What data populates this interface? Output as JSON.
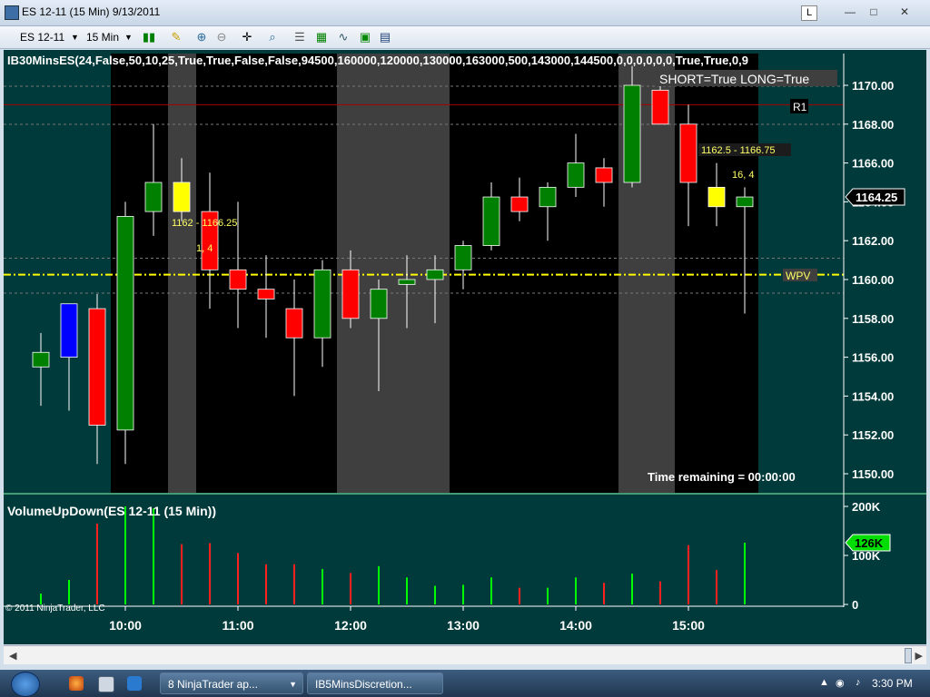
{
  "window": {
    "title": "ES 12-11 (15 Min)  9/13/2011",
    "l_label": "L",
    "min_btn": "—",
    "max_btn": "□",
    "close_btn": "✕"
  },
  "toolbar": {
    "instrument": "ES 12-11",
    "interval": "15 Min"
  },
  "indicator_label": "IB30MinsES(24,False,50,10,25,True,True,False,False,94500,160000,120000,130000,163000,500,143000,144500,0,0,0,0,0,0,True,True,0,9",
  "annotations": {
    "short_long": "SHORT=True LONG=True",
    "r1": "R1",
    "range1": "1162.5 - 1166.75",
    "range2": "1162 - 1166.25",
    "count1": "16, 4",
    "count2": "1, 4",
    "wpv": "WPV",
    "time_remaining": "Time remaining = 00:00:00",
    "last_price": "1164.25",
    "copyright": "© 2011 NinjaTrader, LLC"
  },
  "volume_panel": {
    "title": "VolumeUpDown(ES 12-11 (15 Min))",
    "last_volume": "126K"
  },
  "colors": {
    "bg": "#003a3a",
    "plot_black": "#000000",
    "session_gray": "#3f3f3f",
    "up": "#008000",
    "down": "#ff0000",
    "doji": "#ffff00",
    "blue": "#0000ff",
    "wpv": "#ffff00",
    "r1": "#aa0000"
  },
  "chart_data": {
    "type": "candlestick",
    "y_ticks": [
      "1170.00",
      "1168.00",
      "1166.00",
      "1164.00",
      "1162.00",
      "1160.00",
      "1158.00",
      "1156.00",
      "1154.00",
      "1152.00",
      "1150.00"
    ],
    "ylim": [
      1149,
      1171
    ],
    "x_ticks": [
      "10:00",
      "11:00",
      "12:00",
      "13:00",
      "14:00",
      "15:00"
    ],
    "r1_level": 1169,
    "wpv_level": 1160.25,
    "candles": [
      {
        "o": 1155.5,
        "h": 1157.25,
        "l": 1153.5,
        "c": 1156.25,
        "color": "up"
      },
      {
        "o": 1156,
        "h": 1158.75,
        "l": 1153.25,
        "c": 1158.75,
        "color": "blue"
      },
      {
        "o": 1158.5,
        "h": 1159.25,
        "l": 1150.5,
        "c": 1152.5,
        "color": "down"
      },
      {
        "o": 1152.25,
        "h": 1164,
        "l": 1150.5,
        "c": 1163.25,
        "color": "up"
      },
      {
        "o": 1163.5,
        "h": 1168,
        "l": 1162.25,
        "c": 1165,
        "color": "up"
      },
      {
        "o": 1165,
        "h": 1166.25,
        "l": 1163,
        "c": 1163.5,
        "color": "doji"
      },
      {
        "o": 1163.5,
        "h": 1165.5,
        "l": 1158.5,
        "c": 1160.5,
        "color": "down"
      },
      {
        "o": 1160.5,
        "h": 1164,
        "l": 1157.5,
        "c": 1159.5,
        "color": "down"
      },
      {
        "o": 1159.5,
        "h": 1161.25,
        "l": 1157,
        "c": 1159,
        "color": "down"
      },
      {
        "o": 1158.5,
        "h": 1160,
        "l": 1154,
        "c": 1157,
        "color": "down"
      },
      {
        "o": 1157,
        "h": 1161,
        "l": 1155.5,
        "c": 1160.5,
        "color": "up"
      },
      {
        "o": 1160.5,
        "h": 1161.5,
        "l": 1157.5,
        "c": 1158,
        "color": "down"
      },
      {
        "o": 1158,
        "h": 1160,
        "l": 1154.25,
        "c": 1159.5,
        "color": "up"
      },
      {
        "o": 1159.75,
        "h": 1161.25,
        "l": 1157.5,
        "c": 1160,
        "color": "up"
      },
      {
        "o": 1160,
        "h": 1161.25,
        "l": 1157.75,
        "c": 1160.5,
        "color": "up"
      },
      {
        "o": 1160.5,
        "h": 1162,
        "l": 1159.5,
        "c": 1161.75,
        "color": "up"
      },
      {
        "o": 1161.75,
        "h": 1165,
        "l": 1161.5,
        "c": 1164.25,
        "color": "up"
      },
      {
        "o": 1164.25,
        "h": 1165.25,
        "l": 1163,
        "c": 1163.5,
        "color": "down"
      },
      {
        "o": 1163.75,
        "h": 1165,
        "l": 1162,
        "c": 1164.75,
        "color": "up"
      },
      {
        "o": 1164.75,
        "h": 1167.5,
        "l": 1164.25,
        "c": 1166,
        "color": "up"
      },
      {
        "o": 1165.75,
        "h": 1166.25,
        "l": 1163.75,
        "c": 1165,
        "color": "down"
      },
      {
        "o": 1165,
        "h": 1171,
        "l": 1164.75,
        "c": 1170,
        "color": "up"
      },
      {
        "o": 1169.75,
        "h": 1170.25,
        "l": 1168,
        "c": 1168,
        "color": "down"
      },
      {
        "o": 1168,
        "h": 1169,
        "l": 1162.75,
        "c": 1165,
        "color": "down"
      },
      {
        "o": 1164.75,
        "h": 1166,
        "l": 1162.75,
        "c": 1163.75,
        "color": "doji"
      },
      {
        "o": 1163.75,
        "h": 1164.75,
        "l": 1158.25,
        "c": 1164.25,
        "color": "up"
      }
    ],
    "volume_ticks": [
      "200K",
      "100K",
      "0"
    ],
    "volume_max": 200,
    "volume": [
      {
        "v": 22,
        "dir": "up"
      },
      {
        "v": 50,
        "dir": "up"
      },
      {
        "v": 165,
        "dir": "down"
      },
      {
        "v": 200,
        "dir": "up"
      },
      {
        "v": 196,
        "dir": "up"
      },
      {
        "v": 123,
        "dir": "down"
      },
      {
        "v": 125,
        "dir": "down"
      },
      {
        "v": 105,
        "dir": "down"
      },
      {
        "v": 82,
        "dir": "down"
      },
      {
        "v": 82,
        "dir": "down"
      },
      {
        "v": 72,
        "dir": "up"
      },
      {
        "v": 64,
        "dir": "down"
      },
      {
        "v": 78,
        "dir": "up"
      },
      {
        "v": 55,
        "dir": "up"
      },
      {
        "v": 38,
        "dir": "up"
      },
      {
        "v": 40,
        "dir": "up"
      },
      {
        "v": 55,
        "dir": "up"
      },
      {
        "v": 34,
        "dir": "down"
      },
      {
        "v": 34,
        "dir": "up"
      },
      {
        "v": 55,
        "dir": "up"
      },
      {
        "v": 44,
        "dir": "down"
      },
      {
        "v": 63,
        "dir": "up"
      },
      {
        "v": 47,
        "dir": "down"
      },
      {
        "v": 121,
        "dir": "down"
      },
      {
        "v": 70,
        "dir": "down"
      },
      {
        "v": 126,
        "dir": "up"
      }
    ]
  },
  "taskbar": {
    "task1": "8  NinjaTrader ap...",
    "task2": "IB5MinsDiscretion...",
    "time": "3:30 PM"
  }
}
